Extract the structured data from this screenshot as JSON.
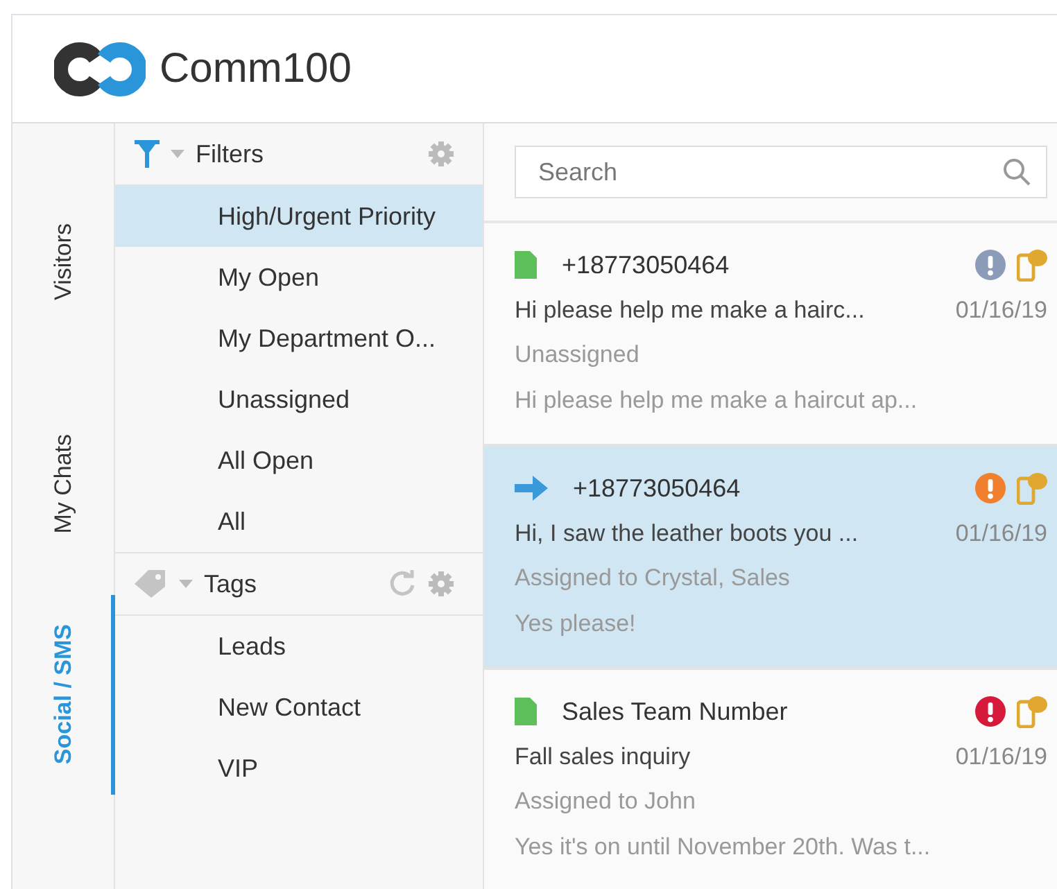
{
  "brand": {
    "name": "Comm100"
  },
  "side_tabs": [
    {
      "label": "Visitors",
      "selected": false
    },
    {
      "label": "My Chats",
      "selected": false
    },
    {
      "label": "Social / SMS",
      "selected": true
    }
  ],
  "filters": {
    "title": "Filters",
    "items": [
      {
        "label": "High/Urgent Priority",
        "selected": true
      },
      {
        "label": "My Open",
        "selected": false
      },
      {
        "label": "My Department O...",
        "selected": false
      },
      {
        "label": "Unassigned",
        "selected": false
      },
      {
        "label": "All Open",
        "selected": false
      },
      {
        "label": "All",
        "selected": false
      }
    ]
  },
  "tags": {
    "title": "Tags",
    "items": [
      {
        "label": "Leads",
        "selected": false
      },
      {
        "label": "New Contact",
        "selected": false
      },
      {
        "label": "VIP",
        "selected": false
      }
    ]
  },
  "search": {
    "placeholder": "Search"
  },
  "conversations": [
    {
      "kind": "new",
      "name": "+18773050464",
      "color": "#8c9cb8",
      "preview": "Hi please help me make a hairc...",
      "date": "01/16/19",
      "assignee": "Unassigned",
      "last_message": "Hi please help me make a haircut ap...",
      "selected": false
    },
    {
      "kind": "active",
      "name": "+18773050464",
      "color": "#f0802e",
      "preview": "Hi, I saw the leather boots you ...",
      "date": "01/16/19",
      "assignee": "Assigned to Crystal, Sales",
      "last_message": "Yes please!",
      "selected": true
    },
    {
      "kind": "new",
      "name": "Sales Team Number",
      "color": "#d61a3c",
      "preview": "Fall sales inquiry",
      "date": "01/16/19",
      "assignee": "Assigned to John",
      "last_message": "Yes it's on until November 20th. Was t...",
      "selected": false
    }
  ]
}
